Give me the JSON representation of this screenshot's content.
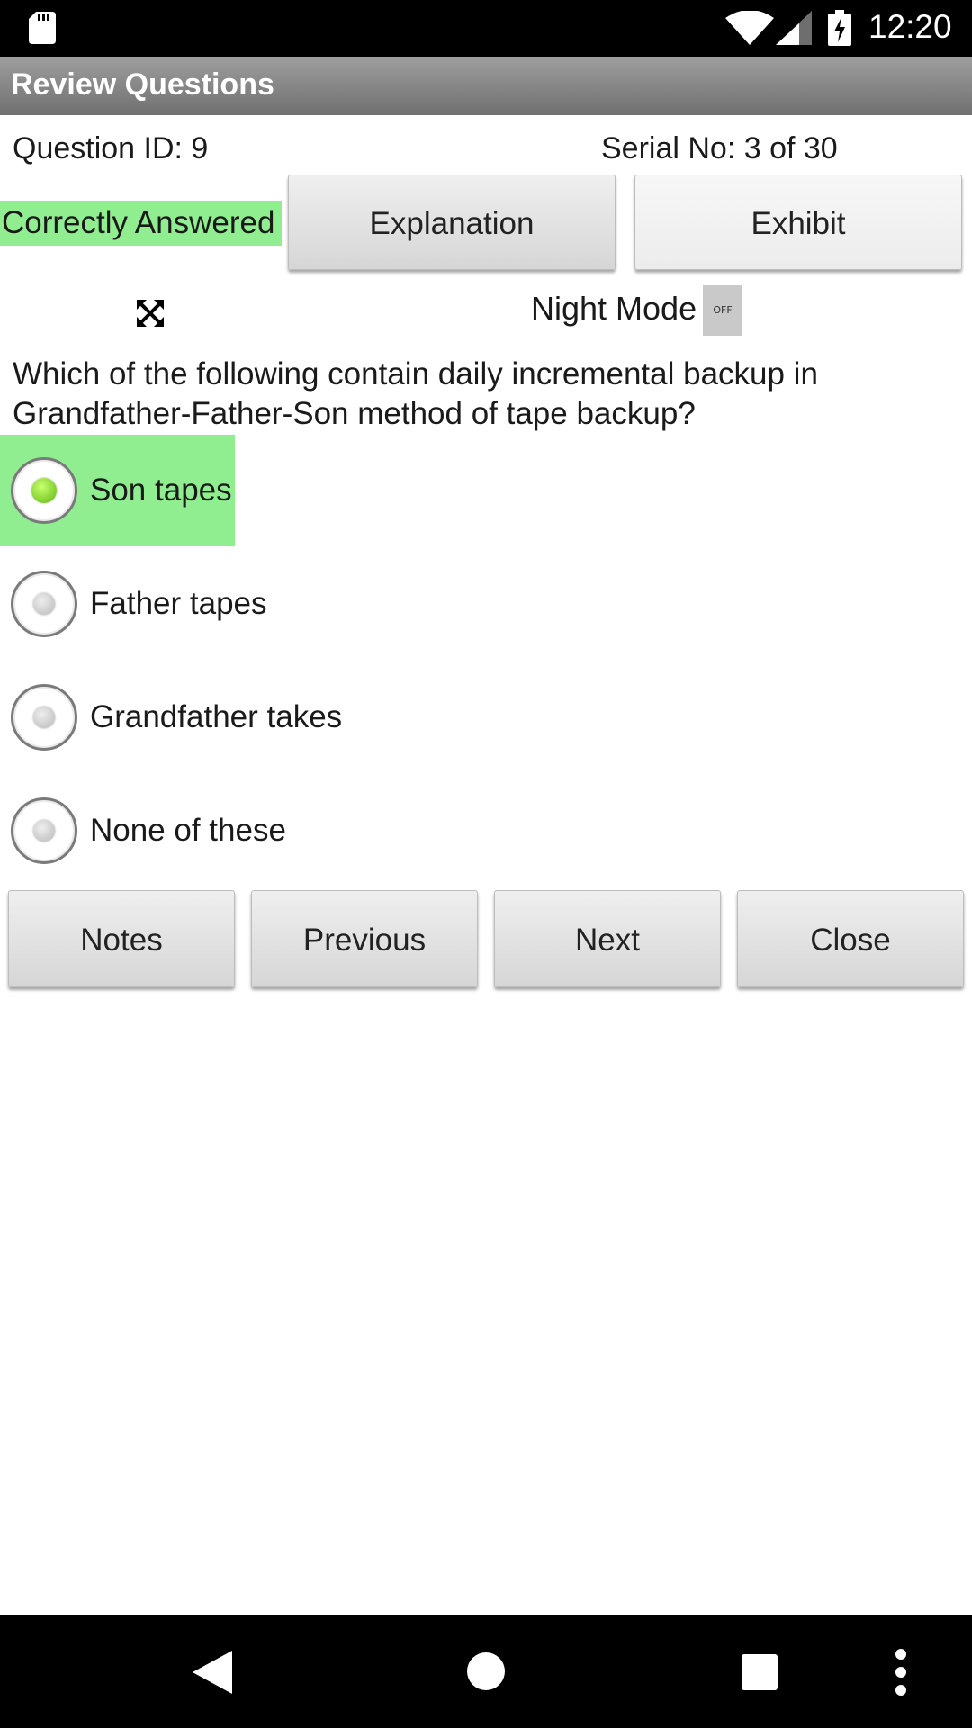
{
  "status_bar": {
    "time": "12:20"
  },
  "app": {
    "title": "Review Questions"
  },
  "header": {
    "question_id": "Question ID: 9",
    "serial": "Serial No: 3 of 30",
    "status_badge": "Correctly Answered",
    "explanation_label": "Explanation",
    "exhibit_label": "Exhibit"
  },
  "night_mode": {
    "label": "Night Mode",
    "toggle": "OFF"
  },
  "question": {
    "text": "Which of the following contain daily incremental backup in Grandfather-Father-Son method of tape backup?",
    "options": [
      {
        "label": "Son tapes",
        "selected": true
      },
      {
        "label": "Father tapes",
        "selected": false
      },
      {
        "label": "Grandfather takes",
        "selected": false
      },
      {
        "label": "None of these",
        "selected": false
      }
    ]
  },
  "actions": {
    "notes": "Notes",
    "previous": "Previous",
    "next": "Next",
    "close": "Close"
  },
  "colors": {
    "correct_highlight": "#90ee90",
    "title_bar": "#8a8a8a",
    "radio_selected": "#7ed321"
  },
  "icons": {
    "status": [
      "sd-card-icon",
      "wifi-icon",
      "cellular-signal-icon",
      "battery-charging-icon"
    ],
    "nav": [
      "back-icon",
      "home-icon",
      "recent-apps-icon",
      "overflow-menu-icon"
    ],
    "page": [
      "fullscreen-expand-icon"
    ]
  }
}
